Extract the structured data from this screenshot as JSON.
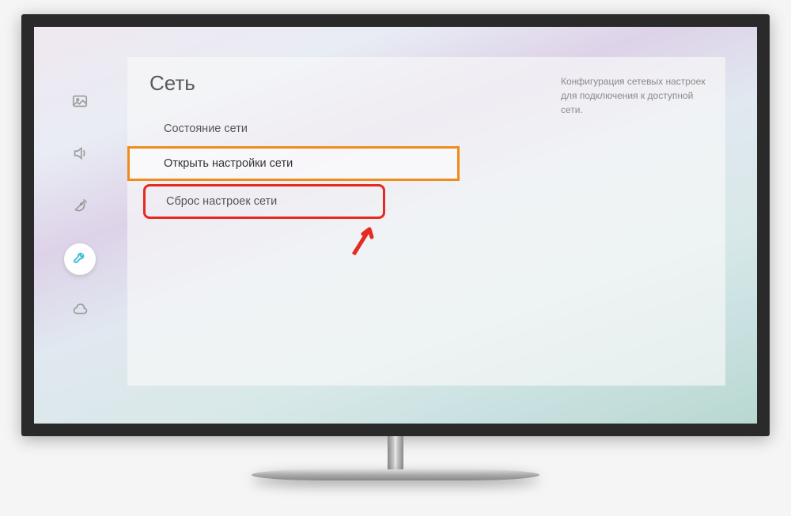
{
  "panel": {
    "title": "Сеть",
    "description": "Конфигурация сетевых настроек для подключения к доступной сети."
  },
  "menu": {
    "items": [
      {
        "label": "Состояние сети"
      },
      {
        "label": "Открыть настройки сети"
      },
      {
        "label": "Сброс настроек сети"
      }
    ]
  },
  "sidebar": {
    "items": [
      {
        "name": "picture"
      },
      {
        "name": "sound"
      },
      {
        "name": "broadcast"
      },
      {
        "name": "general",
        "active": true
      },
      {
        "name": "support"
      }
    ]
  }
}
